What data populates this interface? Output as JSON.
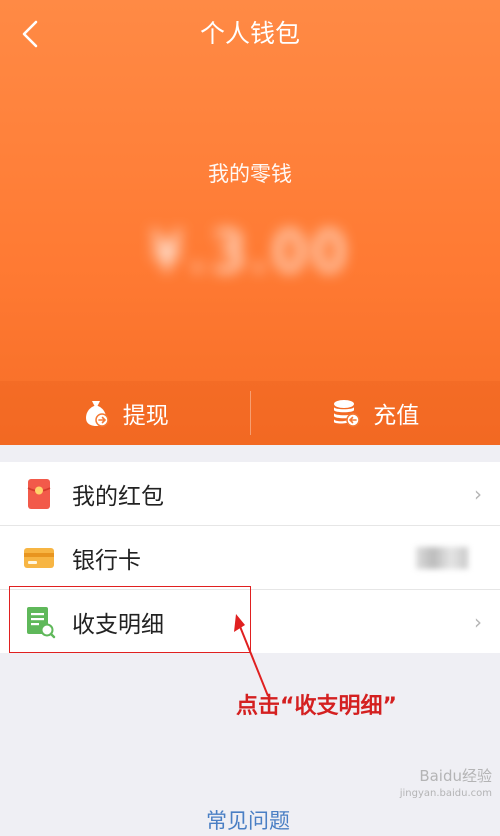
{
  "nav": {
    "title": "个人钱包",
    "back_icon": "chevron-left-icon"
  },
  "wallet": {
    "balance_label": "我的零钱",
    "balance_value_masked": "¥.3.00"
  },
  "actions": [
    {
      "label": "提现",
      "icon": "money-bag-icon"
    },
    {
      "label": "充值",
      "icon": "coin-stack-icon"
    }
  ],
  "menu": [
    {
      "label": "我的红包",
      "icon": "red-envelope-icon"
    },
    {
      "label": "银行卡",
      "icon": "bank-card-icon"
    },
    {
      "label": "收支明细",
      "icon": "statement-icon"
    }
  ],
  "annotation": {
    "text": "点击“收支明细”"
  },
  "footer": {
    "faq_label": "常见问题"
  },
  "watermark": {
    "text": "Baidu经验",
    "sub": "jingyan.baidu.com"
  },
  "colors": {
    "primary": "#ff7a33",
    "annotation_red": "#d42020",
    "link_blue": "#4a7fc4"
  }
}
